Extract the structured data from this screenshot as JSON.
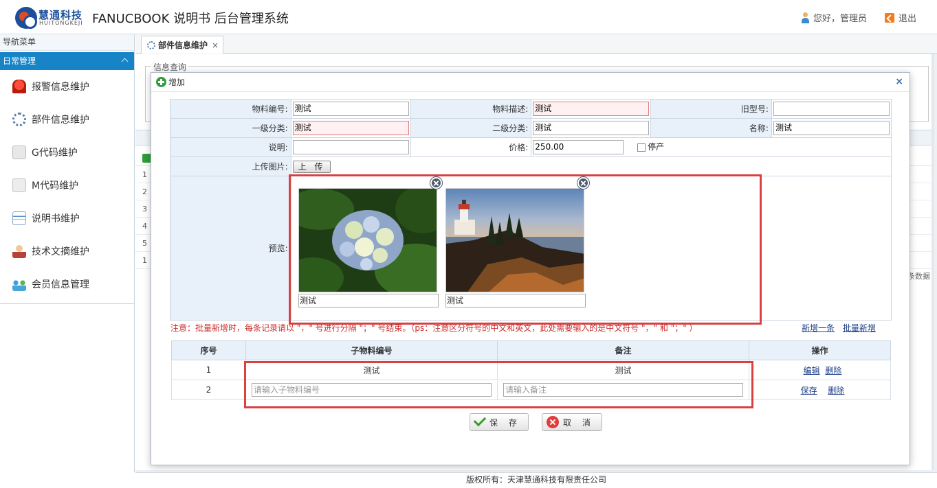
{
  "header": {
    "logo_cn": "慧通科技",
    "logo_en": "HUITONGKEJI",
    "title": "FANUCBOOK 说明书 后台管理系统",
    "greeting": "您好，管理员",
    "logout": "退出"
  },
  "sidebar": {
    "title": "导航菜单",
    "group": "日常管理",
    "items": [
      {
        "label": "报警信息维护",
        "icon": "alarm-icon"
      },
      {
        "label": "部件信息维护",
        "icon": "gear-icon"
      },
      {
        "label": "G代码维护",
        "icon": "g-code-icon"
      },
      {
        "label": "M代码维护",
        "icon": "m-code-icon"
      },
      {
        "label": "说明书维护",
        "icon": "manual-icon"
      },
      {
        "label": "技术文摘维护",
        "icon": "person-icon"
      },
      {
        "label": "会员信息管理",
        "icon": "members-icon"
      }
    ]
  },
  "tab": {
    "label": "部件信息维护",
    "close": "×"
  },
  "background": {
    "fieldset_legend": "信息查询",
    "row_numbers": [
      "1",
      "2",
      "3",
      "4",
      "5"
    ],
    "pager_first": "1",
    "right_text": "条数据"
  },
  "dialog": {
    "title": "增加",
    "close": "×",
    "fields": {
      "material_no": {
        "label": "物料编号:",
        "value": "测试"
      },
      "material_desc": {
        "label": "物料描述:",
        "value": "测试"
      },
      "old_model": {
        "label": "旧型号:",
        "value": ""
      },
      "category1": {
        "label": "一级分类:",
        "value": "测试"
      },
      "category2": {
        "label": "二级分类:",
        "value": "测试"
      },
      "name": {
        "label": "名称:",
        "value": "测试"
      },
      "description": {
        "label": "说明:",
        "value": ""
      },
      "price": {
        "label": "价格:",
        "value": "250.00"
      },
      "discontinued": {
        "label": "停产",
        "checked": false
      },
      "upload": {
        "label": "上传图片:",
        "button": "上 传"
      },
      "preview": {
        "label": "预览:"
      }
    },
    "images": [
      {
        "caption": "测试",
        "subject": "hydrangea"
      },
      {
        "caption": "测试",
        "subject": "lighthouse"
      }
    ],
    "notice": "注意：批量新增时，每条记录请以 \"，\" 号进行分隔 \"；\" 号结束。（ps：注意区分符号的中文和英文，此处需要输入的是中文符号 \"，\" 和 \"；\" ）",
    "links": {
      "add_one": "新增一条",
      "add_batch": "批量新增"
    },
    "sub_table": {
      "headers": [
        "序号",
        "子物料编号",
        "备注",
        "操作"
      ],
      "rows": [
        {
          "no": "1",
          "code": "测试",
          "remark": "测试",
          "ops": [
            "编辑",
            "删除"
          ]
        },
        {
          "no": "2",
          "code_placeholder": "请输入子物料编号",
          "remark_placeholder": "请输入备注",
          "ops": [
            "保存",
            "删除"
          ]
        }
      ]
    },
    "buttons": {
      "save": "保 存",
      "cancel": "取 消"
    }
  },
  "footer": "版权所有：天津慧通科技有限责任公司",
  "colors": {
    "nav_active": "#1784c7",
    "highlight_box": "#d94141",
    "notice": "#cc2a2a"
  }
}
